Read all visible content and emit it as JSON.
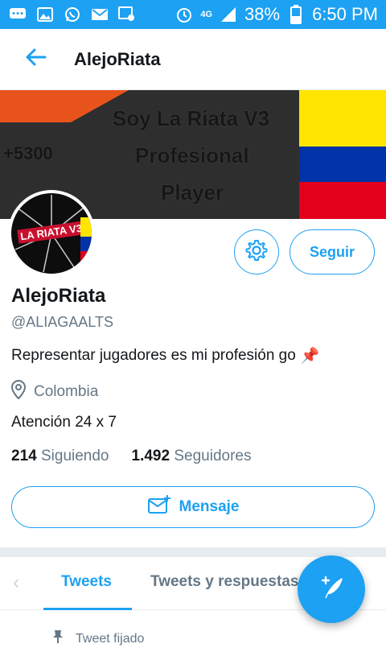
{
  "status_bar": {
    "battery": "38%",
    "time": "6:50 PM",
    "network": "4G",
    "icons": [
      "chat-icon",
      "gallery-icon",
      "whatsapp-icon",
      "mail-icon",
      "settings-icon",
      "alarm-icon",
      "signal-icon",
      "battery-icon"
    ]
  },
  "header": {
    "title": "AlejoRiata",
    "back_icon": "arrow-left-icon"
  },
  "banner": {
    "score": "+5300",
    "line1": "Soy La Riata V3",
    "line2": "Profesional",
    "line3": "Player"
  },
  "avatar": {
    "text": "LA RIATA V3"
  },
  "profile": {
    "name": "AlejoRiata",
    "handle": "@ALIAGAALTS",
    "bio": "Representar jugadores es mi profesión go",
    "bio_emoji": "📌",
    "location": "Colombia",
    "extra_line": "Atención 24 x 7",
    "following_count": "214",
    "following_label": "Siguiendo",
    "followers_count": "1.492",
    "followers_label": "Seguidores"
  },
  "actions": {
    "follow_label": "Seguir",
    "message_label": "Mensaje"
  },
  "tabs": {
    "items": [
      {
        "label": "Tweets",
        "active": true
      },
      {
        "label": "Tweets y respuestas",
        "active": false
      }
    ]
  },
  "pinned": {
    "label": "Tweet fijado"
  },
  "colors": {
    "accent": "#1da1f2",
    "text": "#14171a",
    "secondary": "#657786"
  }
}
